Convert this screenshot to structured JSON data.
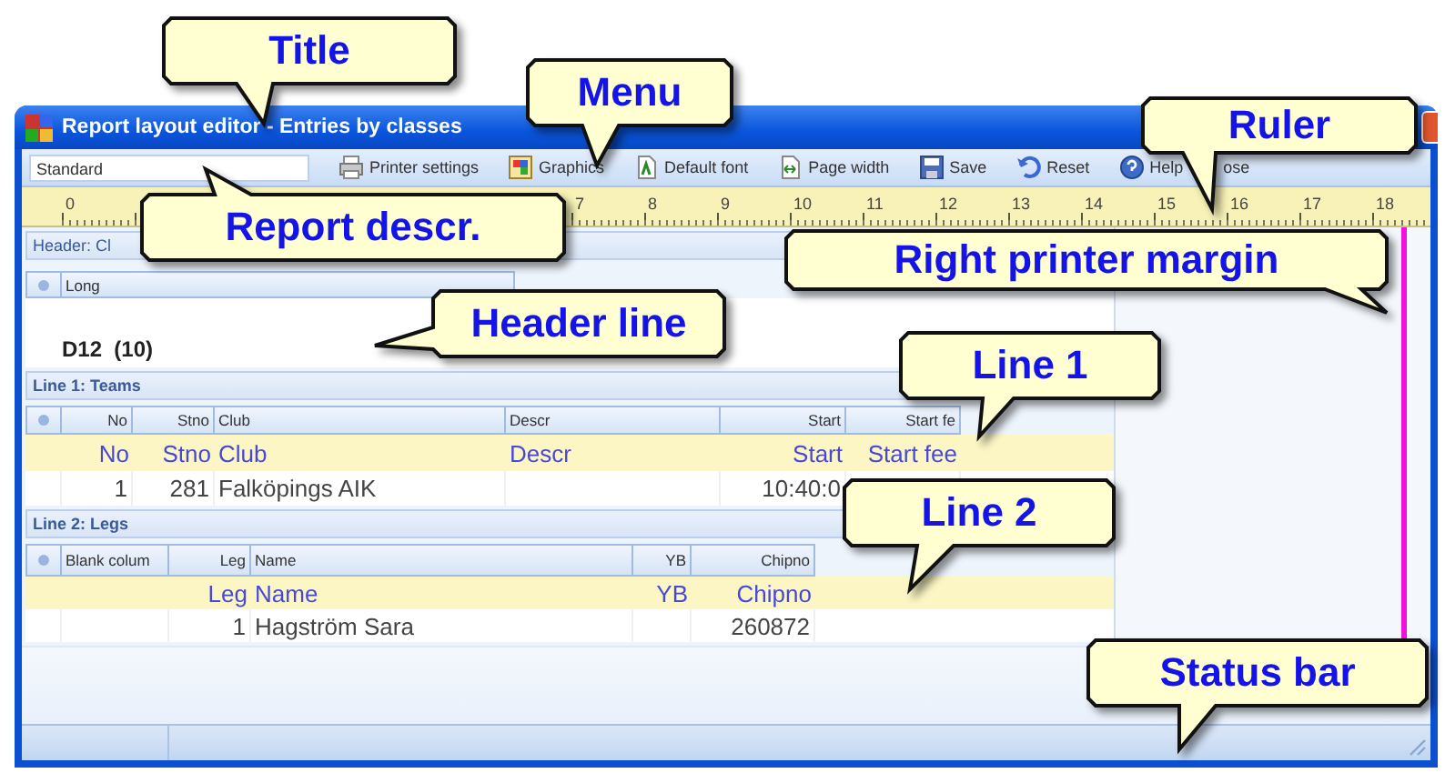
{
  "window": {
    "title": "Report layout editor - Entries by classes"
  },
  "toolbar": {
    "report_description": "Standard",
    "buttons": [
      {
        "label": "Printer settings",
        "kind": "printer"
      },
      {
        "label": "Graphics",
        "kind": "graphics"
      },
      {
        "label": "Default font",
        "kind": "font"
      },
      {
        "label": "Page width",
        "kind": "width"
      },
      {
        "label": "Save",
        "kind": "save"
      },
      {
        "label": "Reset",
        "kind": "reset"
      },
      {
        "label": "Help",
        "kind": "help"
      },
      {
        "label": "ose",
        "kind": "text"
      }
    ]
  },
  "ruler": {
    "labels": [
      "0",
      "7",
      "8",
      "9",
      "10",
      "11",
      "12",
      "13",
      "14",
      "15",
      "16",
      "17",
      "18"
    ]
  },
  "header_section": {
    "label": "Header: Cl",
    "column": "Long",
    "text": "D12  (10)"
  },
  "line_sections": [
    {
      "label": "Line 1: Teams",
      "columns": [
        "No",
        "Stno",
        "Club",
        "Descr",
        "Start",
        "Start fe"
      ],
      "field_row": {
        "no": "No",
        "stno": "Stno",
        "club": "Club",
        "descr": "Descr",
        "start": "Start",
        "start_fee": "Start fee"
      },
      "data_row": {
        "no": "1",
        "stno": "281",
        "club": "Falköpings AIK",
        "start": "10:40:0"
      }
    },
    {
      "label": "Line 2: Legs",
      "columns": [
        "Blank colum",
        "Leg",
        "Name",
        "YB",
        "Chipno"
      ],
      "field_row": {
        "leg": "Leg",
        "name": "Name",
        "yb": "YB",
        "chipno": "Chipno"
      },
      "data_row": {
        "leg": "1",
        "name": "Hagström Sara",
        "chipno": "260872"
      }
    }
  ],
  "callouts": [
    {
      "text": "Title"
    },
    {
      "text": "Menu"
    },
    {
      "text": "Ruler"
    },
    {
      "text": "Report descr."
    },
    {
      "text": "Right printer margin"
    },
    {
      "text": "Header line"
    },
    {
      "text": "Line 1"
    },
    {
      "text": "Line 2"
    },
    {
      "text": "Status bar"
    }
  ]
}
